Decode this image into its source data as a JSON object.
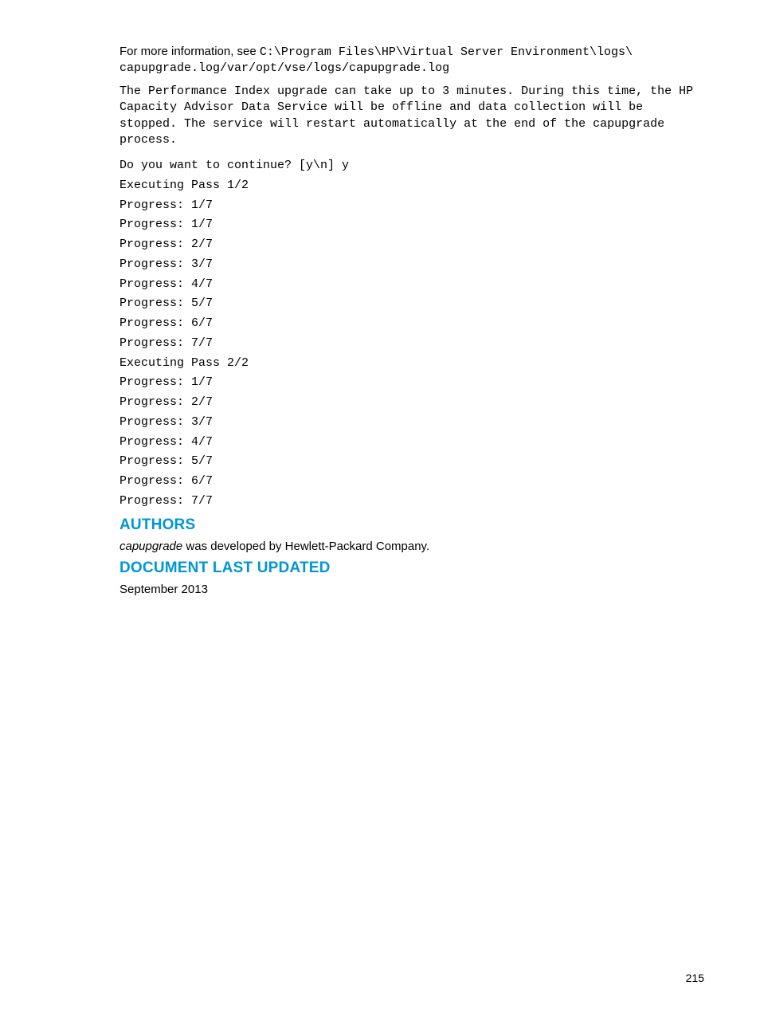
{
  "intro": {
    "prefix": "For more information, see ",
    "path1": "C:\\Program Files\\HP\\Virtual Server Environment\\logs\\",
    "path2": "capupgrade.log/var/opt/vse/logs/capupgrade.log"
  },
  "paragraph": "The Performance Index upgrade can take up to 3 minutes. During this time, the HP Capacity Advisor Data Service will be offline and data collection will be stopped. The service will restart automatically at the end of the capupgrade process.",
  "log_lines": [
    "Do you want to continue? [y\\n] y",
    "Executing Pass 1/2",
    "Progress: 1/7",
    "Progress: 1/7",
    "Progress: 2/7",
    "Progress: 3/7",
    "Progress: 4/7",
    "Progress: 5/7",
    "Progress: 6/7",
    "Progress: 7/7",
    "Executing Pass 2/2",
    "Progress: 1/7",
    "Progress: 2/7",
    "Progress: 3/7",
    "Progress: 4/7",
    "Progress: 5/7",
    "Progress: 6/7",
    "Progress: 7/7"
  ],
  "authors": {
    "heading": "AUTHORS",
    "prefix_italic": "capupgrade",
    "rest": " was developed by Hewlett-Packard Company."
  },
  "updated": {
    "heading": "DOCUMENT LAST UPDATED",
    "date": "September 2013"
  },
  "page_number": "215"
}
